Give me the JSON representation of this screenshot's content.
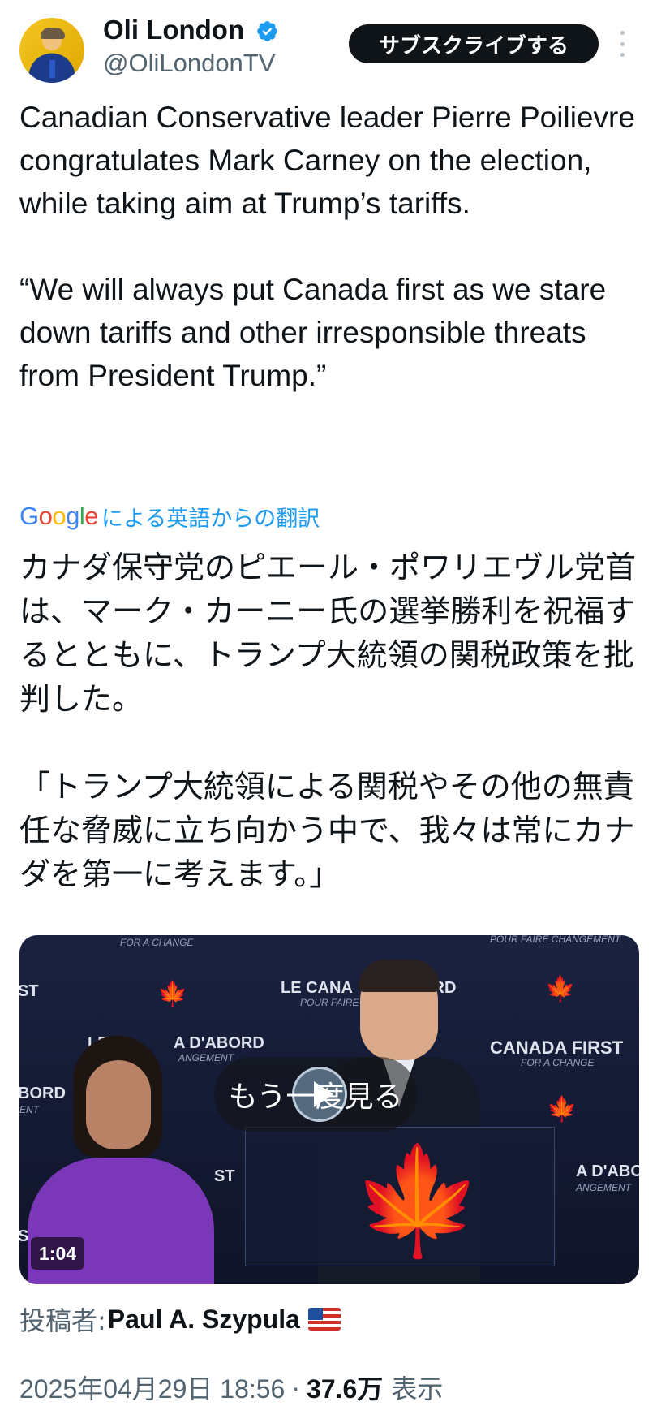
{
  "author": {
    "name": "Oli London",
    "handle": "@OliLondonTV",
    "verified_icon": "verified-badge-icon",
    "avatar_icon": "avatar"
  },
  "header": {
    "subscribe_label": "サブスクライブする",
    "more_icon": "more-vertical-icon"
  },
  "tweet": {
    "paragraphs": [
      "Canadian Conservative leader Pierre Poilievre congratulates Mark Carney on the election, while taking aim at Trump’s tariffs.",
      "“We will always put Canada first as we stare down tariffs and other irresponsible threats from President Trump.”"
    ]
  },
  "translation": {
    "provider": "Google",
    "label": "による英語からの翻訳",
    "paragraphs": [
      "カナダ保守党のピエール・ポワリエヴル党首は、マーク・カーニー氏の選挙勝利を祝福するとともに、トランプ大統領の関税政策を批判した。",
      "「トランプ大統領による関税やその他の無責任な脅威に立ち向かう中で、我々は常にカナダを第一に考えます。」"
    ]
  },
  "video": {
    "replay_label": "もう一度見る",
    "duration": "1:04",
    "backdrop": {
      "canada_first": "CANADA FIRST",
      "for_a_change": "FOR A CHANGE",
      "le_canada": "LE CANA",
      "dabord": "ORD",
      "pour_faire": "POUR FAIRE",
      "changement": "CHANGEMENT",
      "pour_faire_changement": "POUR FAIRE CHANGEMENT",
      "le_left": "LE",
      "a_dabord_left": "A D'ABORD",
      "angement_left": "ANGEMENT",
      "st_left": "ST",
      "bord_left": "BORD",
      "ent_left": "ENT",
      "st_mid": "ST",
      "st_bottom": "ST",
      "a_dabord_right": "A D'ABORD",
      "angement_right": "ANGEMENT"
    },
    "colors": {
      "background": "#1b2240",
      "maple_red": "#d62a1e",
      "dress_purple": "#7a37b8"
    }
  },
  "footer": {
    "posted_by_label": "投稿者:",
    "posted_by_name": "Paul A. Szypula",
    "flag": "us-flag-icon",
    "timestamp": "2025年04月29日 18:56",
    "separator": "·",
    "views": "37.6万",
    "views_label": "表示"
  },
  "colors": {
    "text_primary": "#0f1419",
    "text_secondary": "#536471",
    "link_blue": "#1d9bf0",
    "verified_blue": "#1d9bf0",
    "button_dark": "#0f1419"
  }
}
